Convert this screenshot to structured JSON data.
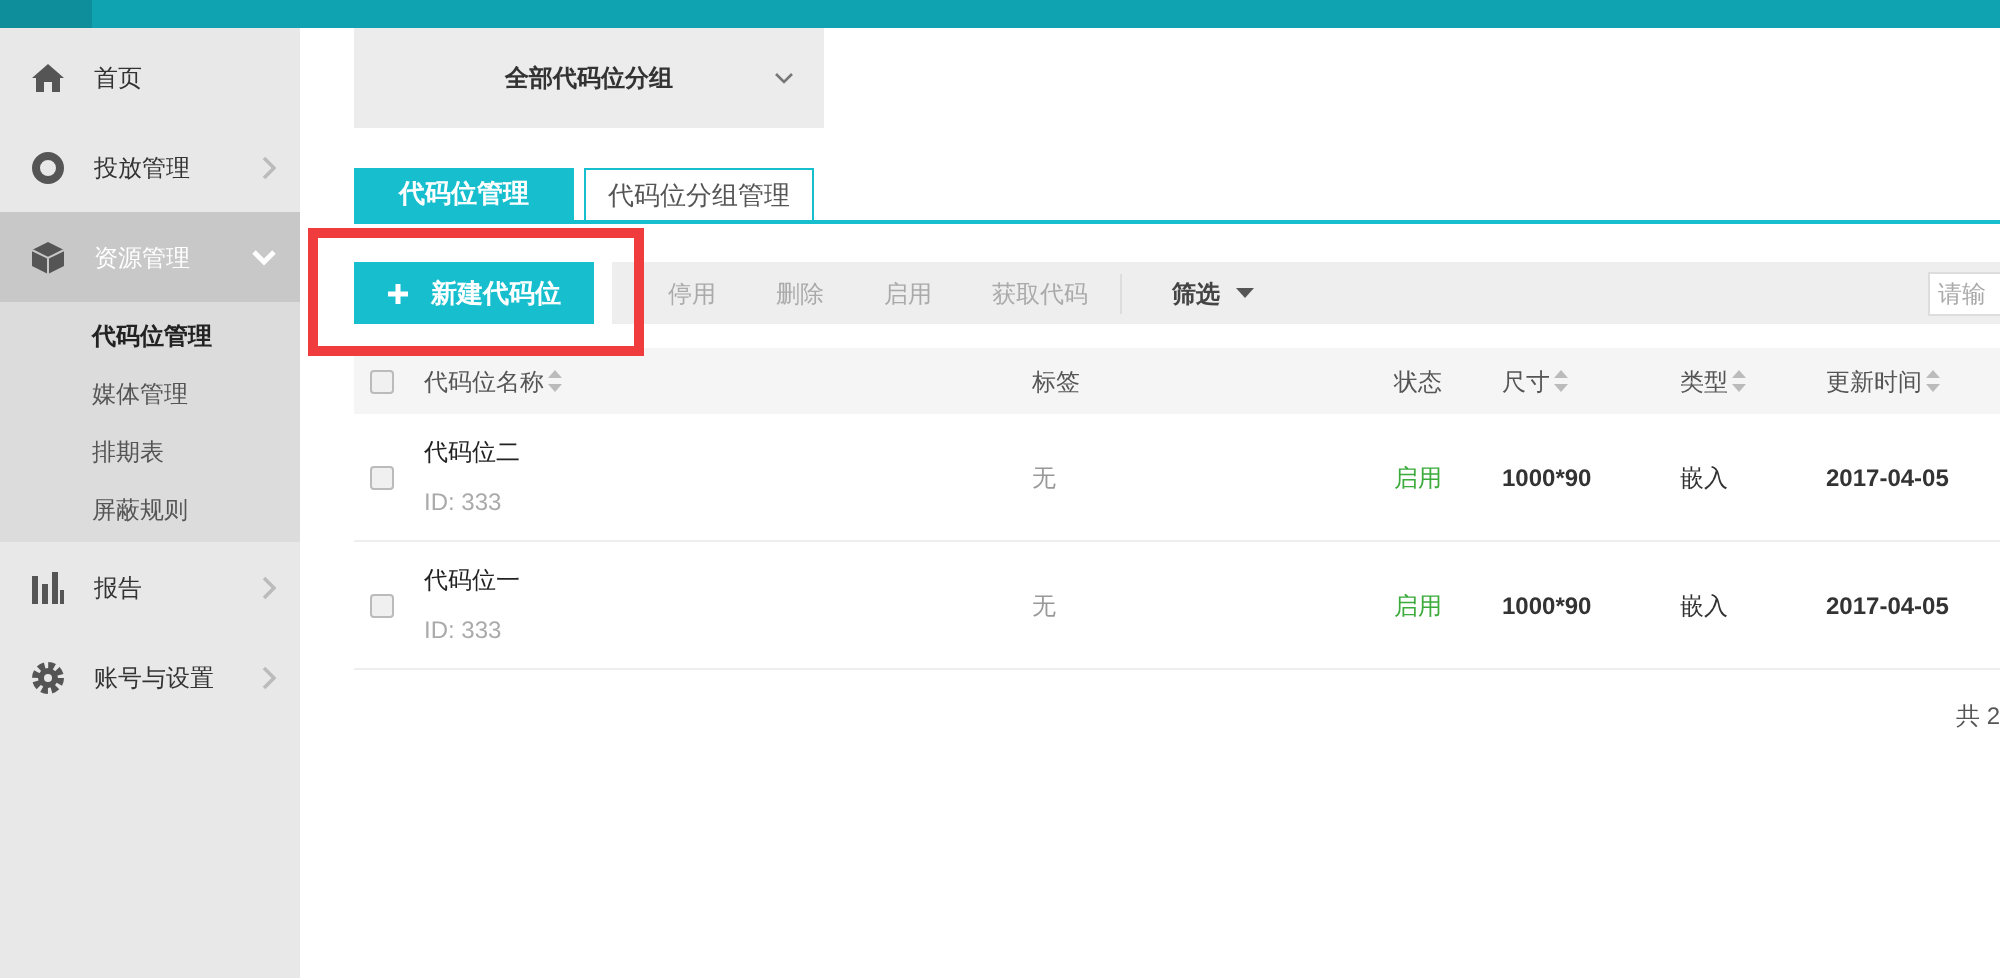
{
  "sidebar": {
    "items": [
      {
        "label": "首页",
        "has_arrow": false,
        "expanded": false,
        "selected": false
      },
      {
        "label": "投放管理",
        "has_arrow": true,
        "expanded": false,
        "selected": false
      },
      {
        "label": "资源管理",
        "has_arrow": true,
        "expanded": true,
        "selected": true,
        "children": [
          {
            "label": "代码位管理",
            "selected": true
          },
          {
            "label": "媒体管理",
            "selected": false
          },
          {
            "label": "排期表",
            "selected": false
          },
          {
            "label": "屏蔽规则",
            "selected": false
          }
        ]
      },
      {
        "label": "报告",
        "has_arrow": true,
        "expanded": false,
        "selected": false
      },
      {
        "label": "账号与设置",
        "has_arrow": true,
        "expanded": false,
        "selected": false
      }
    ]
  },
  "group_select": {
    "value": "全部代码位分组"
  },
  "tabs": [
    {
      "label": "代码位管理",
      "selected": true
    },
    {
      "label": "代码位分组管理",
      "selected": false
    }
  ],
  "toolbar": {
    "primary": "新建代码位",
    "actions": [
      "停用",
      "删除",
      "启用",
      "获取代码"
    ],
    "filter": "筛选",
    "search": {
      "placeholder": "请输"
    }
  },
  "table": {
    "all_checked": false,
    "columns": [
      {
        "label": "代码位名称",
        "sortable": true
      },
      {
        "label": "标签",
        "sortable": false
      },
      {
        "label": "状态",
        "sortable": false
      },
      {
        "label": "尺寸",
        "sortable": true
      },
      {
        "label": "类型",
        "sortable": true
      },
      {
        "label": "更新时间",
        "sortable": true
      }
    ],
    "rows": [
      {
        "checked": false,
        "name": "代码位二",
        "id": "ID: 333",
        "tag": "无",
        "status": "启用",
        "enabled": true,
        "size": "1000*90",
        "type": "嵌入",
        "updated": "2017-04-05"
      },
      {
        "checked": false,
        "name": "代码位一",
        "id": "ID: 333",
        "tag": "无",
        "status": "启用",
        "enabled": true,
        "size": "1000*90",
        "type": "嵌入",
        "updated": "2017-04-05"
      }
    ]
  },
  "total": "共 2"
}
